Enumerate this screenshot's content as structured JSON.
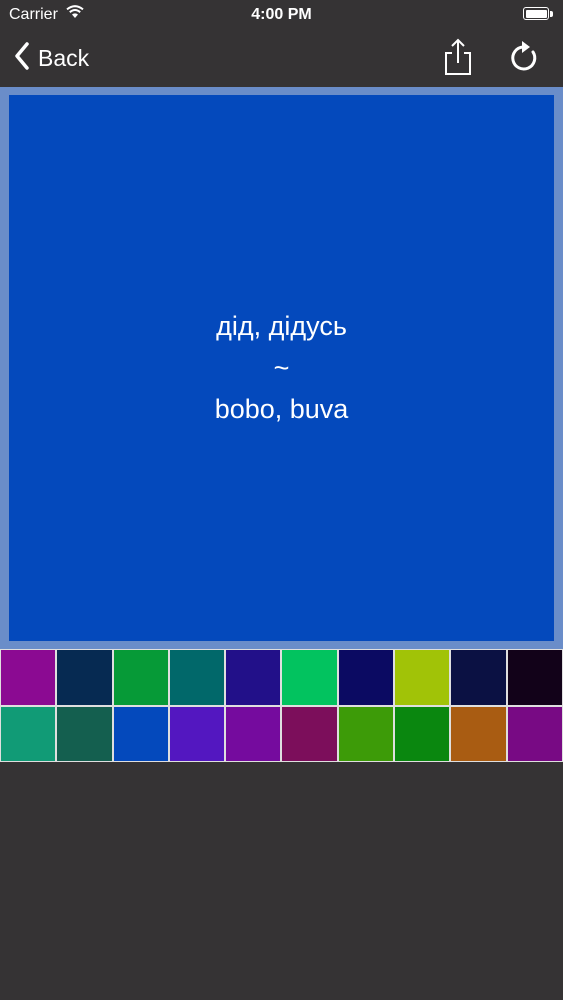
{
  "status_bar": {
    "carrier": "Carrier",
    "time": "4:00 PM",
    "battery_level": 1.0
  },
  "nav_bar": {
    "back_label": "Back",
    "share_icon": "share-icon",
    "refresh_icon": "refresh-icon"
  },
  "card": {
    "term": "дід, дідусь",
    "separator": "~",
    "translation": "bobo, buva",
    "background_color": "#0449bc",
    "frame_color": "#6a8dc9"
  },
  "palette": {
    "colors": [
      "#8b0a92",
      "#062a52",
      "#069a37",
      "#01686a",
      "#221089",
      "#02c35f",
      "#0b0a62",
      "#a1c307",
      "#0b1143",
      "#120219",
      "#119b76",
      "#145f4f",
      "#0449bc",
      "#5317c0",
      "#750b9e",
      "#7c0e5b",
      "#3d9b08",
      "#0a870f",
      "#a95c12",
      "#780a84"
    ]
  }
}
